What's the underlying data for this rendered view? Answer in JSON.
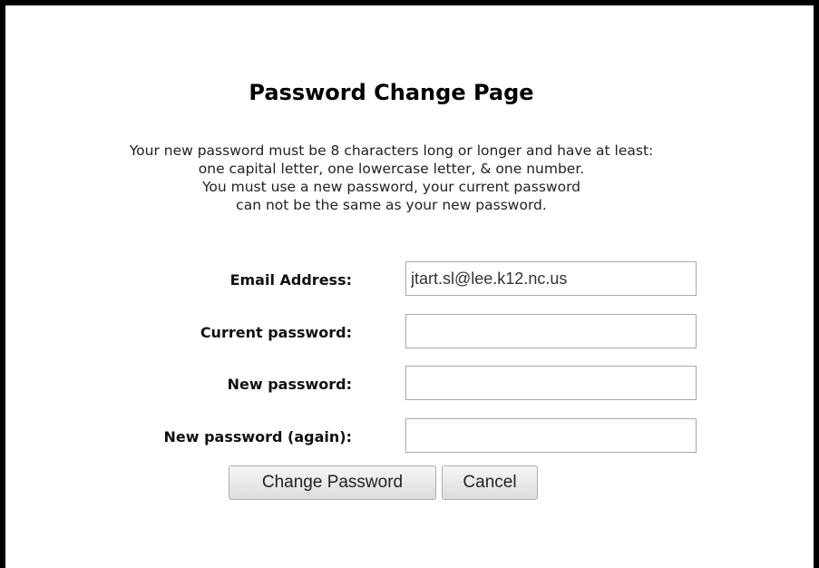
{
  "page": {
    "title": "Password Change Page",
    "instructions": [
      "Your new password must be 8 characters long or longer and have at least:",
      "one capital letter, one lowercase letter, & one number.",
      "You must use a new password, your current password",
      "can not be the same as your new password."
    ]
  },
  "form": {
    "email_label": "Email Address:",
    "email_value": "jtart.sl@lee.k12.nc.us",
    "current_password_label": "Current password:",
    "current_password_value": "",
    "new_password_label": "New password:",
    "new_password_value": "",
    "new_password_again_label": "New password (again):",
    "new_password_again_value": "",
    "change_button_label": "Change Password",
    "cancel_button_label": "Cancel"
  }
}
